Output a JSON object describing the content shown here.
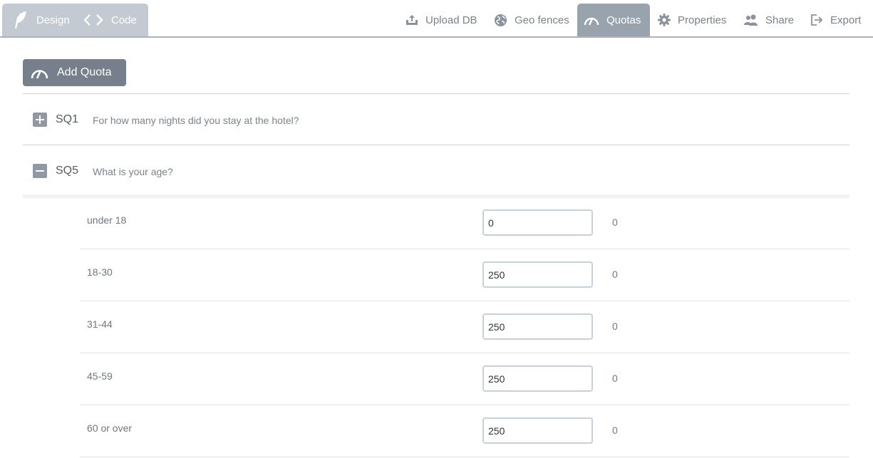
{
  "mode": {
    "design_label": "Design",
    "code_label": "Code"
  },
  "nav": {
    "upload": "Upload DB",
    "geo": "Geo fences",
    "quotas": "Quotas",
    "properties": "Properties",
    "share": "Share",
    "export": "Export",
    "active": "quotas"
  },
  "add_quota_label": "Add Quota",
  "questions": [
    {
      "code": "SQ1",
      "text": "For how many nights did you stay at the hotel?",
      "expanded": false
    },
    {
      "code": "SQ5",
      "text": "What is your age?",
      "expanded": true
    }
  ],
  "options": [
    {
      "label": "under 18",
      "quota": "0",
      "count": "0"
    },
    {
      "label": "18-30",
      "quota": "250",
      "count": "0"
    },
    {
      "label": "31-44",
      "quota": "250",
      "count": "0"
    },
    {
      "label": "45-59",
      "quota": "250",
      "count": "0"
    },
    {
      "label": "60 or over",
      "quota": "250",
      "count": "0"
    }
  ],
  "colors": {
    "accent": "#767f8a",
    "active_tab": "#99a3ae",
    "mode_switch": "#c4cad1"
  }
}
